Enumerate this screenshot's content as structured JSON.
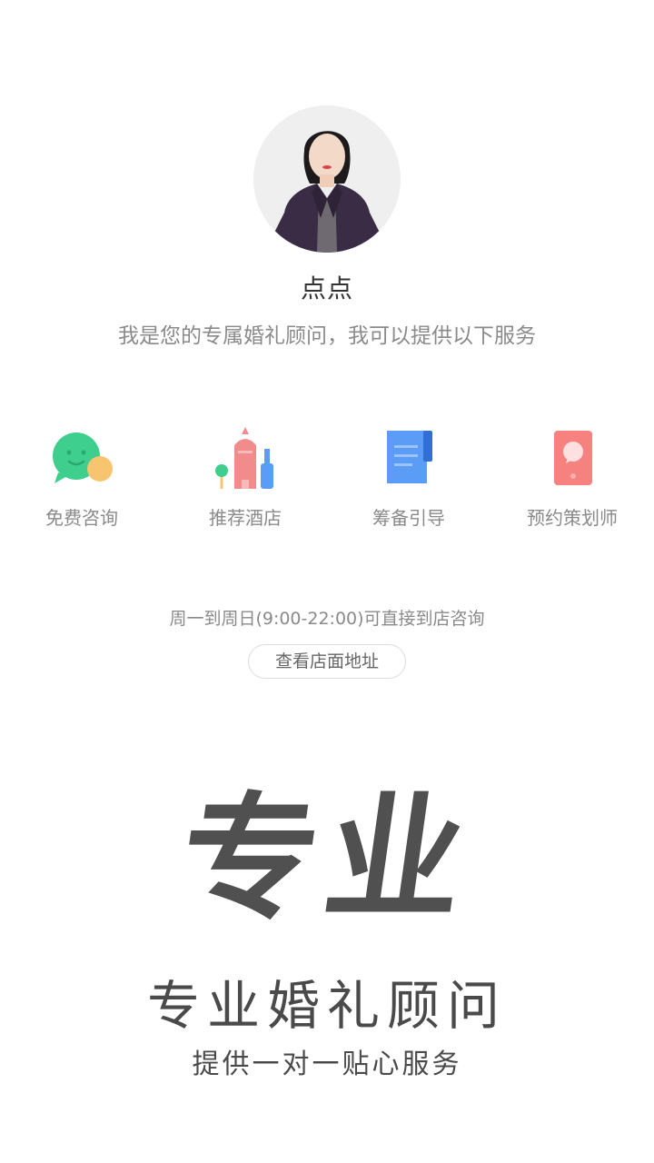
{
  "advisor": {
    "name": "点点",
    "intro": "我是您的专属婚礼顾问，我可以提供以下服务"
  },
  "services": [
    {
      "label": "免费咨询",
      "icon": "chat-bubbles-icon",
      "color": "#3ecf8e"
    },
    {
      "label": "推荐酒店",
      "icon": "hotel-buildings-icon",
      "color": "#f28b8b"
    },
    {
      "label": "筹备引导",
      "icon": "guide-document-icon",
      "color": "#5b9cf6"
    },
    {
      "label": "预约策划师",
      "icon": "phone-message-icon",
      "color": "#f5827f"
    }
  ],
  "store": {
    "hours": "周一到周日(9:00-22:00)可直接到店咨询",
    "address_button": "查看店面地址"
  },
  "banner": {
    "calligraphy": "专业",
    "title": "专业婚礼顾问",
    "subtitle": "提供一对一贴心服务"
  }
}
